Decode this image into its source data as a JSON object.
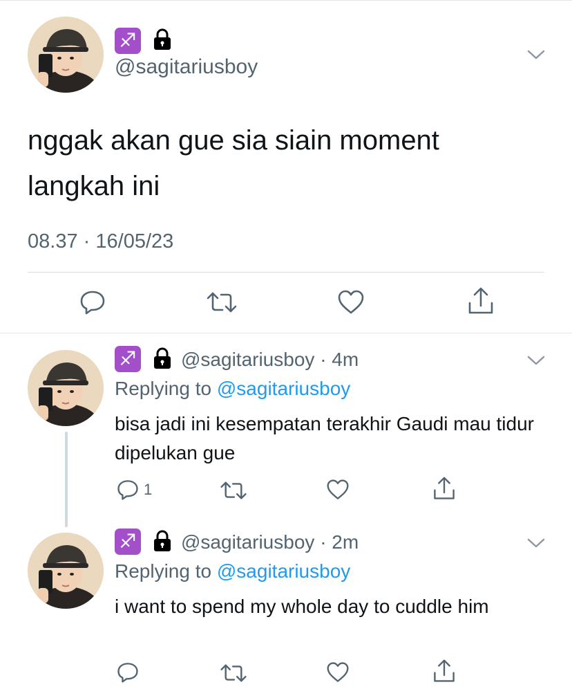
{
  "main_tweet": {
    "badge_emoji": "♐",
    "lock_icon": "lock-icon",
    "handle": "@sagitariusboy",
    "text": "nggak akan gue sia siain moment langkah ini",
    "time": "08.37",
    "separator": "·",
    "date": "16/05/23",
    "actions": [
      "reply-icon",
      "retweet-icon",
      "like-icon",
      "share-icon"
    ]
  },
  "replies": [
    {
      "badge_emoji": "♐",
      "handle": "@sagitariusboy",
      "separator": "·",
      "time": "4m",
      "replying_prefix": "Replying to",
      "replying_handle": "@sagitariusboy",
      "text": "bisa jadi ini kesempatan terakhir Gaudi mau tidur dipelukan gue",
      "reply_count": "1"
    },
    {
      "badge_emoji": "♐",
      "handle": "@sagitariusboy",
      "separator": "·",
      "time": "2m",
      "replying_prefix": "Replying to",
      "replying_handle": "@sagitariusboy",
      "text": "i want to spend my whole day to cuddle him",
      "reply_count": ""
    }
  ],
  "colors": {
    "text": "#0f1419",
    "muted": "#536471",
    "link": "#1d9bf0",
    "badge": "#a24fc9",
    "divider": "#dcdcdc"
  }
}
